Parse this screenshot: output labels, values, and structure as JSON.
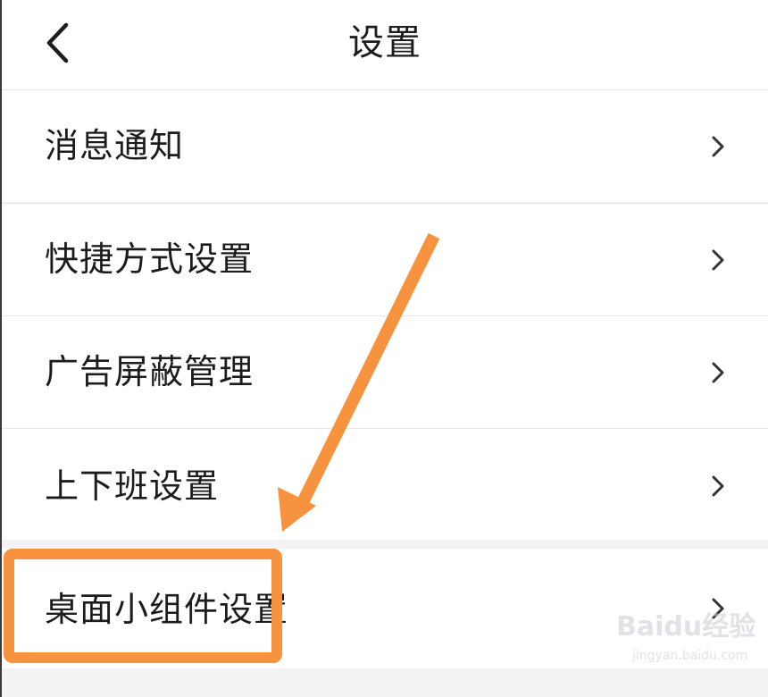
{
  "header": {
    "title": "设置",
    "back_icon": "chevron-left-icon"
  },
  "settings": {
    "items": [
      {
        "label": "消息通知",
        "icon": "chevron-right-icon"
      },
      {
        "label": "快捷方式设置",
        "icon": "chevron-right-icon"
      },
      {
        "label": "广告屏蔽管理",
        "icon": "chevron-right-icon"
      },
      {
        "label": "上下班设置",
        "icon": "chevron-right-icon"
      },
      {
        "label": "桌面小组件设置",
        "icon": "chevron-right-icon"
      }
    ]
  },
  "annotation": {
    "color": "#f7923e",
    "highlighted_item": "桌面小组件设置"
  },
  "watermark": {
    "logo": "Baidu经验",
    "url": "jingyan.baidu.com"
  },
  "colors": {
    "text": "#1c1c1e",
    "background": "#ffffff",
    "separator": "#f3f3f5",
    "chevron": "#333333"
  }
}
